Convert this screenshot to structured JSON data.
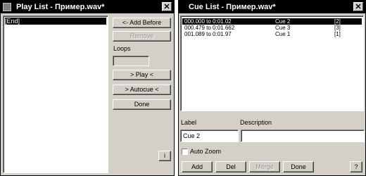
{
  "play_list": {
    "title": "Play List - Пример.wav*",
    "close_glyph": "✕",
    "items": [
      "[End]"
    ],
    "buttons": {
      "add_before": "<- Add Before",
      "remove": "Remove",
      "play": "> Play <",
      "autocue": "> Autocue <",
      "done": "Done",
      "info": "i"
    },
    "loops_label": "Loops",
    "loops_value": ""
  },
  "cue_list": {
    "title": "Cue List - Пример.wav*",
    "close_glyph": "✕",
    "rows": [
      {
        "range": "000.000 to   0:01.02",
        "name": "Cue 2",
        "count": "[2]",
        "selected": true
      },
      {
        "range": "000.479 to   0:01.662",
        "name": "Cue 3",
        "count": "[3]",
        "selected": false
      },
      {
        "range": "001.089 to   0:01.97",
        "name": "Cue 1",
        "count": "[1]",
        "selected": false
      }
    ],
    "label_header": "Label",
    "description_header": "Description",
    "label_value": "Cue 2",
    "description_value": "",
    "auto_zoom": "Auto Zoom",
    "buttons": {
      "add": "Add",
      "del": "Del",
      "merge": "Merge",
      "done": "Done",
      "help": "?"
    }
  }
}
